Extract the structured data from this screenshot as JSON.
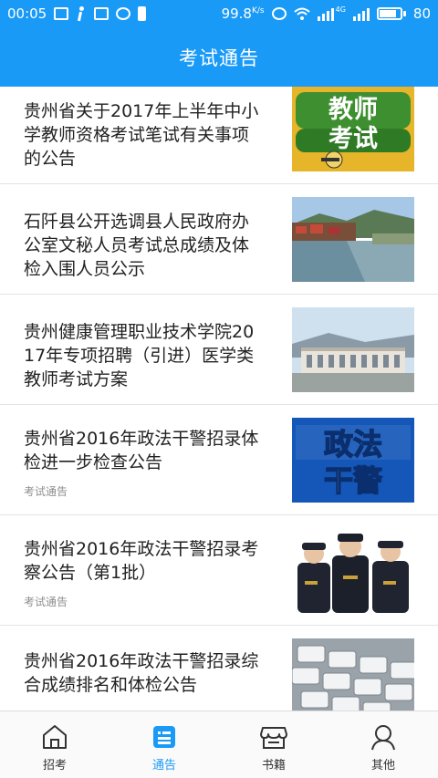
{
  "status_bar": {
    "time": "00:05",
    "speed": "99.8",
    "speed_unit": "K/s",
    "network": "4G",
    "battery": "80"
  },
  "header": {
    "title": "考试通告"
  },
  "articles": [
    {
      "title": "贵州省关于2017年上半年中小学教师资格考试笔试有关事项的公告",
      "tag": "",
      "image": "teacher-exam-banner"
    },
    {
      "title": "石阡县公开选调县人民政府办公室文秘人员考试总成绩及体检入围人员公示",
      "tag": "",
      "image": "river-town-photo"
    },
    {
      "title": "贵州健康管理职业技术学院2017年专项招聘（引进）医学类教师考试方案",
      "tag": "",
      "image": "campus-building-photo"
    },
    {
      "title": "贵州省2016年政法干警招录体检进一步检查公告",
      "tag": "考试通告",
      "image": "police-law-banner"
    },
    {
      "title": "贵州省2016年政法干警招录考察公告（第1批）",
      "tag": "考试通告",
      "image": "police-officers-photo"
    },
    {
      "title": "贵州省2016年政法干警招录综合成绩排名和体检公告",
      "tag": "",
      "image": "keyboard-photo"
    }
  ],
  "thumb_text": {
    "teacher_line1": "教师",
    "teacher_line2": "考试",
    "police_line1": "政法",
    "police_line2": "干警"
  },
  "bottom_nav": [
    {
      "label": "招考",
      "icon": "home-icon",
      "active": false
    },
    {
      "label": "通告",
      "icon": "notice-icon",
      "active": true
    },
    {
      "label": "书籍",
      "icon": "bookstore-icon",
      "active": false
    },
    {
      "label": "其他",
      "icon": "user-icon",
      "active": false
    }
  ],
  "colors": {
    "primary": "#1a9af7",
    "text": "#222222",
    "muted": "#8e8e8e"
  }
}
